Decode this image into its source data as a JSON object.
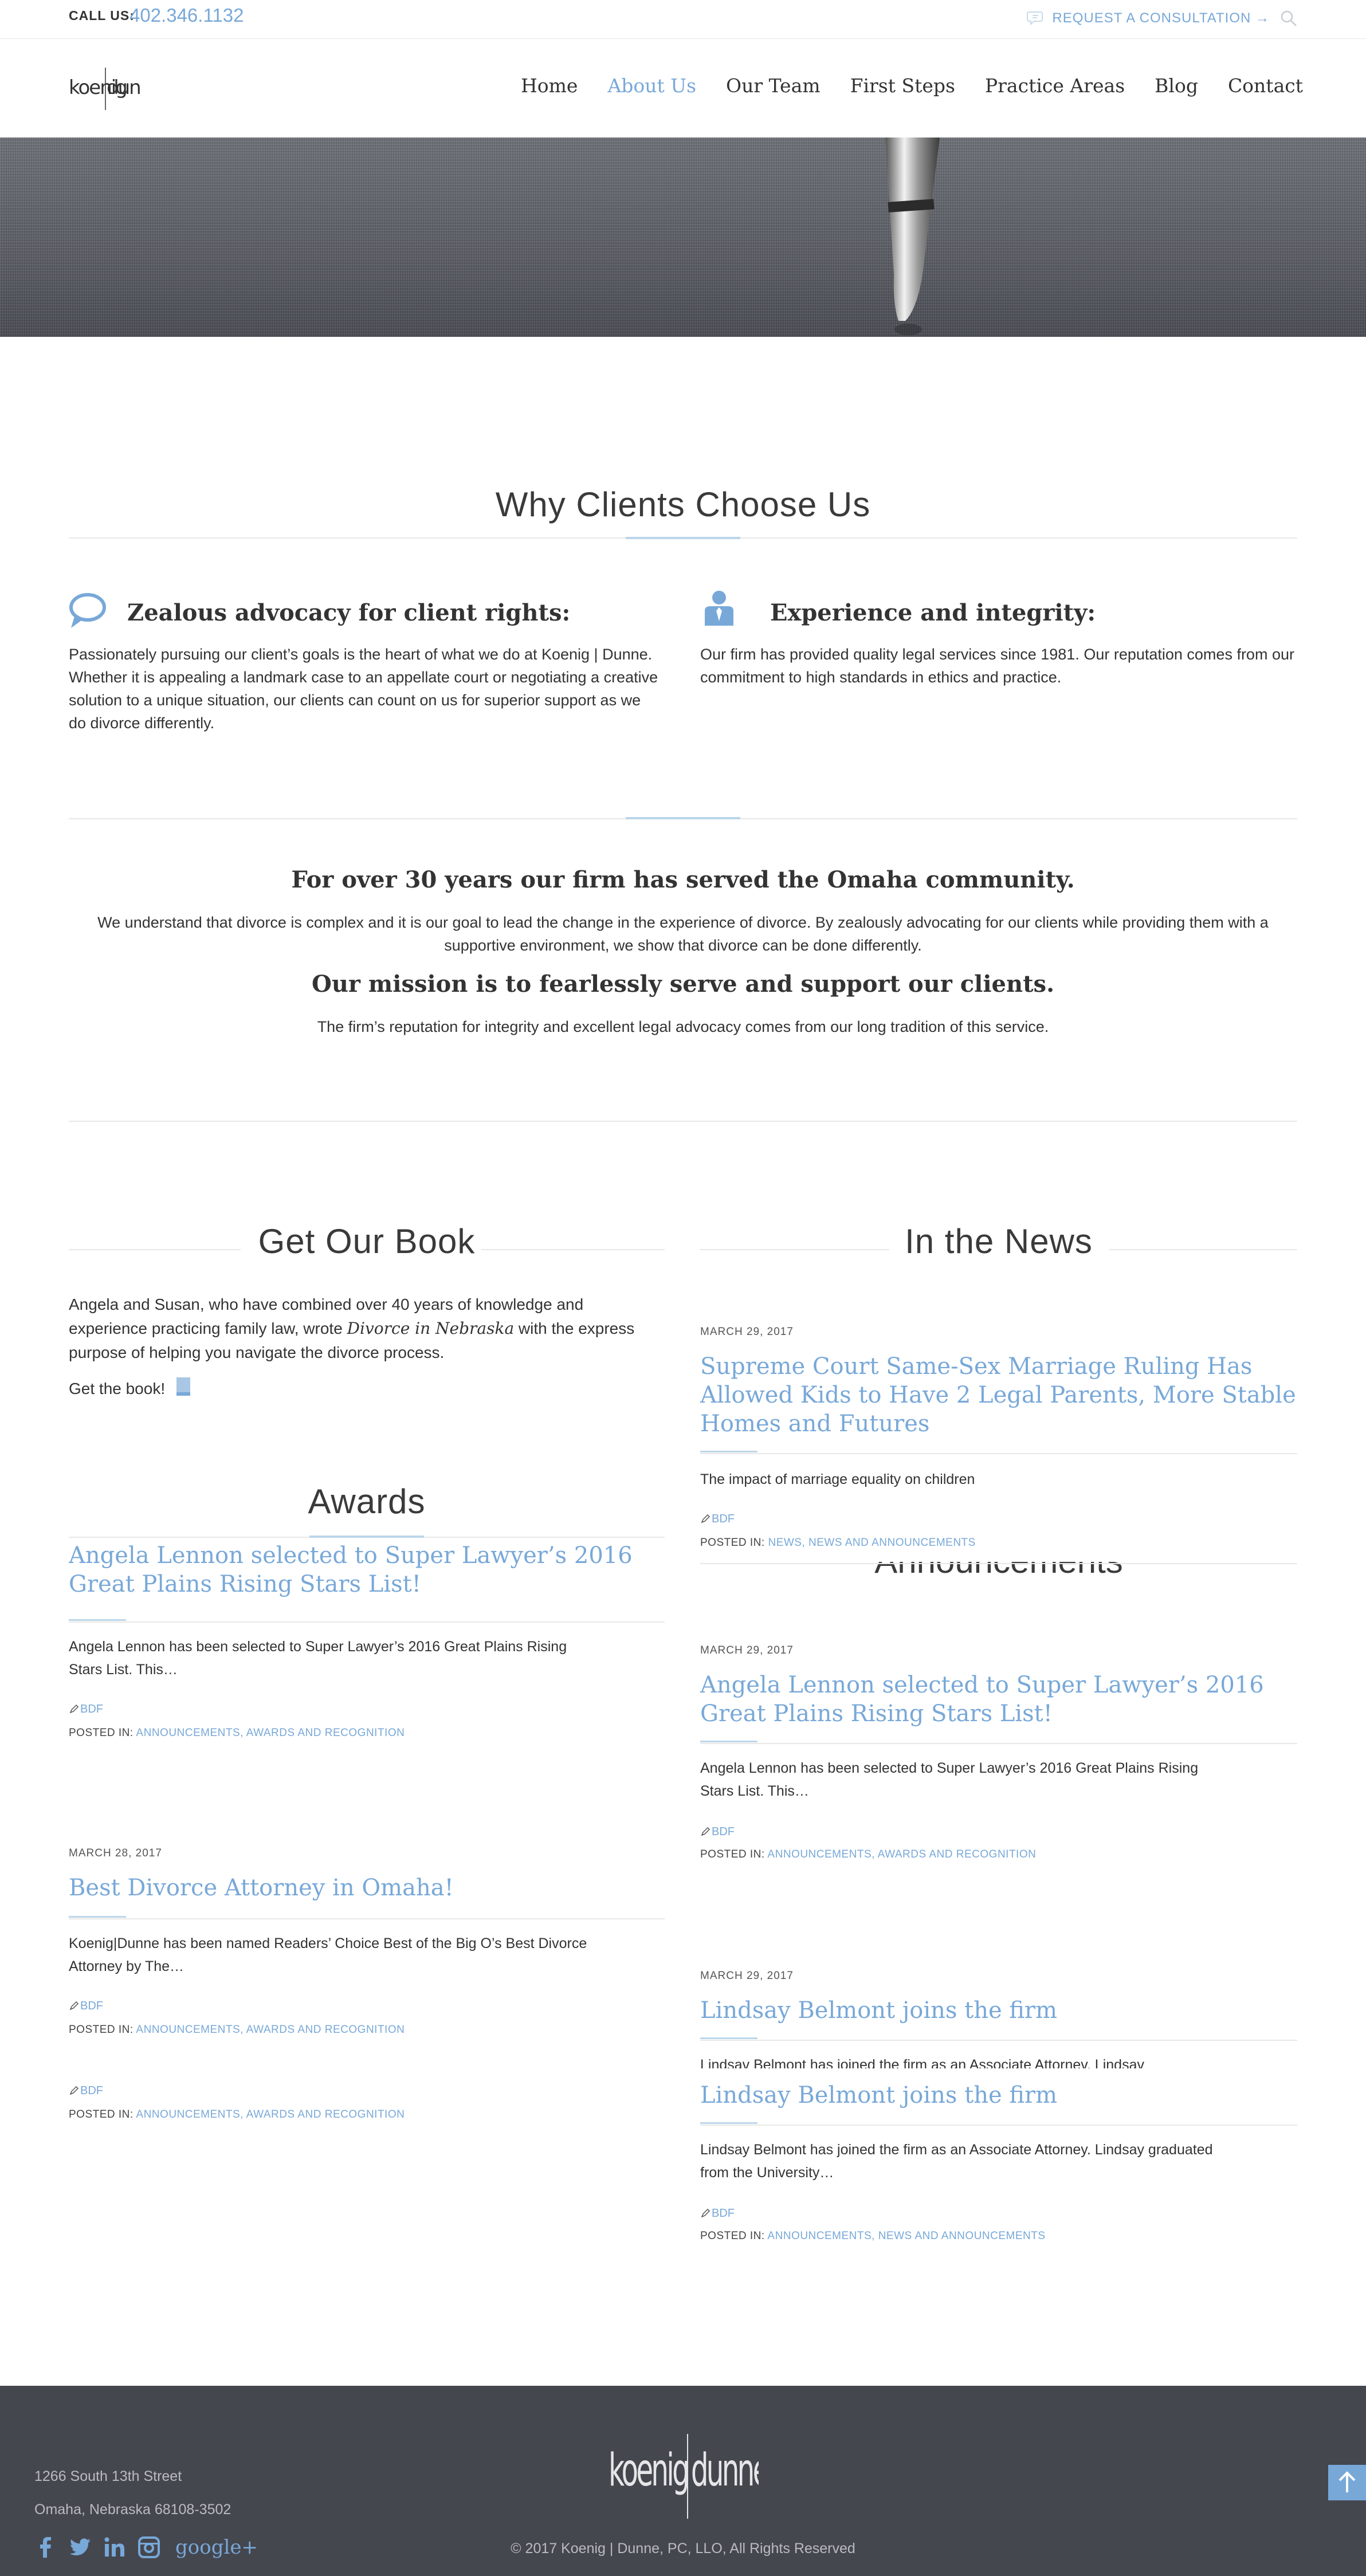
{
  "topbar": {
    "call_label": "CALL US:",
    "phone": "402.346.1132",
    "request_label": "REQUEST A CONSULTATION →"
  },
  "header": {
    "logo_text": "koenig|dunne",
    "nav": [
      "Home",
      "About Us",
      "Our Team",
      "First Steps",
      "Practice Areas",
      "Blog",
      "Contact"
    ],
    "active_nav": "About Us"
  },
  "why": {
    "title": "Why Clients Choose Us",
    "col1_heading": "Zealous advocacy for client rights:",
    "col1_text": "Passionately pursuing our client’s goals is the heart of what we do at Koenig | Dunne. Whether it is appealing a landmark case to an appellate court or negotiating a creative solution to a unique situation, our clients can count on us for superior support as we do divorce differently.",
    "col2_heading": "Experience and integrity:",
    "col2_text": "Our firm has provided quality legal services since 1981. Our reputation comes from our commitment to high standards in ethics and practice."
  },
  "mission": {
    "heading1": "For over 30 years our firm has served the Omaha community.",
    "text1": "We understand that divorce is complex and it is our goal to lead the change in the experience of divorce. By zealously advocating for our clients while providing them with a supportive environment, we show that divorce can be done differently.",
    "heading2": "Our mission is to fearlessly serve and support our clients.",
    "text2": "The firm’s reputation for integrity and excellent legal advocacy comes from our long tradition of this service."
  },
  "book": {
    "title": "Get Our Book",
    "text_before": "Angela and Susan, who have combined over 40 years of knowledge and experience practicing family law, wrote ",
    "book_name": "Divorce in Nebraska",
    "text_after": " with the express purpose of helping you navigate the divorce process.",
    "link": "Get the book!"
  },
  "news": {
    "title": "In the News",
    "date": "MARCH 29, 2017",
    "post_title": "Supreme Court Same-Sex Marriage Ruling Has Allowed Kids to Have 2 Legal Parents, More Stable Homes and Futures",
    "excerpt": "The impact of marriage equality on children",
    "author": "BDF",
    "posted_label": "POSTED IN:",
    "cats": "NEWS, NEWS AND ANNOUNCEMENTS"
  },
  "awards": {
    "title": "Awards",
    "post1_title": "Angela Lennon selected to Super Lawyer’s 2016 Great Plains Rising Stars List!",
    "post1_excerpt": "Angela Lennon has been selected to Super Lawyer’s 2016 Great Plains Rising Stars List. This…",
    "post1_author": "BDF",
    "post1_cats": "ANNOUNCEMENTS, AWARDS AND RECOGNITION",
    "post2_date": "MARCH 28, 2017",
    "post2_title": "Best Divorce Attorney in Omaha!",
    "post2_excerpt": "Koenig|Dunne has been named Readers’ Choice Best of the Big O’s Best Divorce Attorney by The…",
    "post2_author": "BDF",
    "post2_cats": "ANNOUNCEMENTS, AWARDS AND RECOGNITION",
    "post3_author": "BDF",
    "post3_cats": "ANNOUNCEMENTS, AWARDS AND RECOGNITION",
    "posted_label": "POSTED IN:"
  },
  "announcements": {
    "title": "Announcements",
    "post1_date": "MARCH 29, 2017",
    "post1_title": "Angela Lennon selected to Super Lawyer’s 2016 Great Plains Rising Stars List!",
    "post1_excerpt": "Angela Lennon has been selected to Super Lawyer’s 2016 Great Plains Rising Stars List. This…",
    "post1_author": "BDF",
    "post1_cats": "ANNOUNCEMENTS, AWARDS AND RECOGNITION",
    "post2_date": "MARCH 29, 2017",
    "post2_title": "Lindsay Belmont joins the firm",
    "post2_excerpt_cut": "Lindsav Belmont has ioined the firm as an Associate Attornev. Lindsav",
    "post3_title": "Lindsay Belmont joins the firm",
    "post3_excerpt": "Lindsay Belmont has joined the firm as an Associate Attorney. Lindsay graduated from the University…",
    "post3_author": "BDF",
    "post3_cats": "ANNOUNCEMENTS, NEWS AND ANNOUNCEMENTS",
    "posted_label": "POSTED IN:"
  },
  "footer": {
    "address1": "1266 South 13th Street",
    "address2": "Omaha, Nebraska 68108-3502",
    "gplus": "google+",
    "copyright": "© 2017 Koenig | Dunne, PC, LLO, All Rights Reserved",
    "logo_text": "koenig|dunne"
  },
  "colors": {
    "accent": "#78a8d8",
    "footer_bg": "#45474f",
    "accent_line": "#bcd6ea"
  },
  "icons": [
    "chat-bubble-icon",
    "search-icon",
    "speech-bubble-icon",
    "person-tie-icon",
    "book-icon",
    "pen-icon",
    "facebook-icon",
    "twitter-icon",
    "linkedin-icon",
    "instagram-icon",
    "arrow-up-icon"
  ]
}
